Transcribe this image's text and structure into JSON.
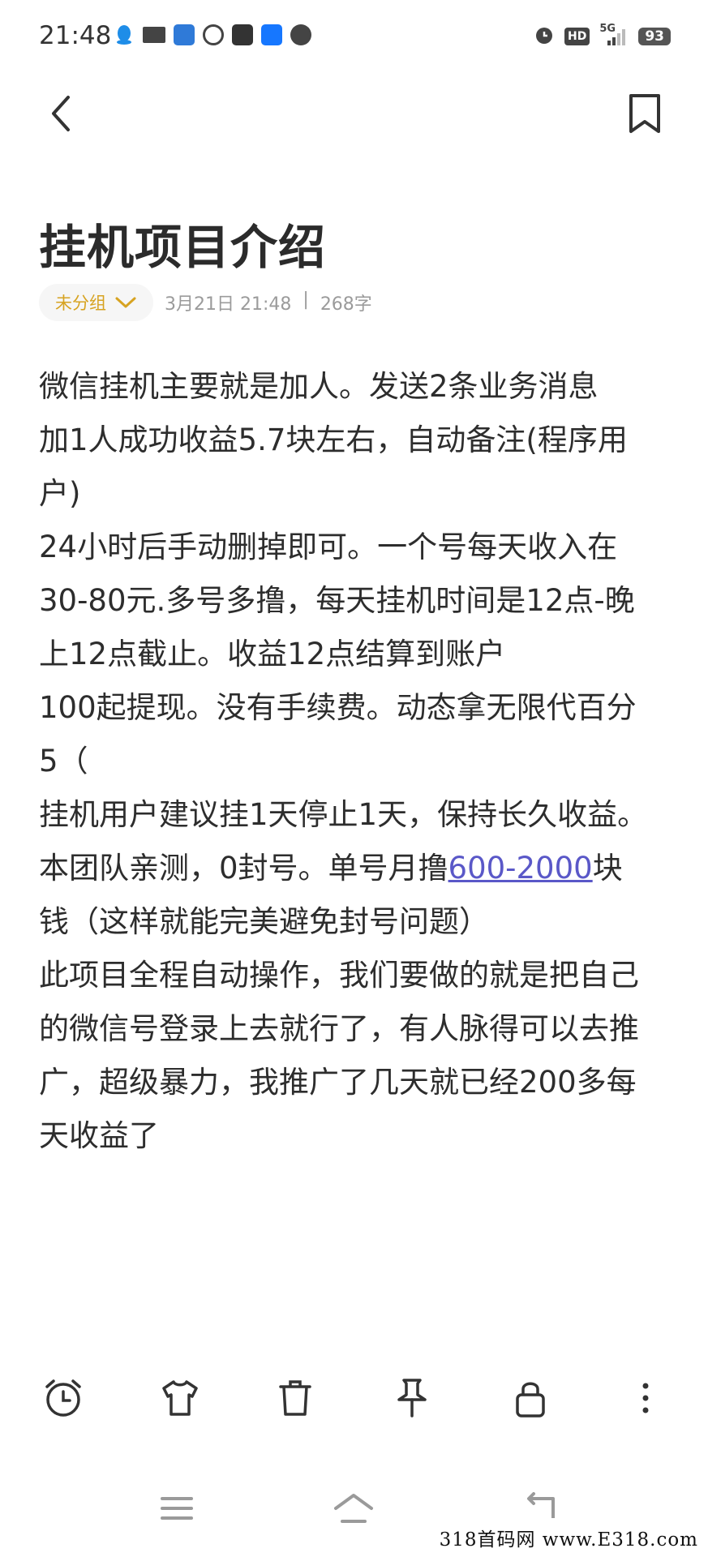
{
  "status_bar": {
    "time": "21:48",
    "notification_icons": [
      "qq-icon",
      "toutiao-icon",
      "signal-app-icon",
      "face-icon",
      "mail-icon",
      "alipay-icon",
      "compass-icon"
    ],
    "right_icons": [
      "alarm-icon",
      "hd-icon",
      "5g-signal-icon"
    ],
    "hd_label": "HD",
    "network_label": "5G",
    "battery": "93"
  },
  "note": {
    "title": "挂机项目介绍",
    "group": "未分组",
    "date": "3月21日 21:48",
    "separator": "|",
    "word_count": "268字",
    "body_lines": [
      "微信挂机主要就是加人。发送2条业务消息",
      "加1人成功收益5.7块左右，自动备注(程序用",
      "户)",
      "24小时后手动删掉即可。一个号每天收入在",
      "30-80元.多号多撸，每天挂机时间是12点-晚",
      "上12点截止。收益12点结算到账户",
      "100起提现。没有手续费。动态拿无限代百分",
      "5（",
      "挂机用户建议挂1天停止1天，保持长久收益。"
    ],
    "link_line": {
      "before": "本团队亲测，0封号。单号月撸",
      "link": "600-2000",
      "after": "块"
    },
    "body_lines_2": [
      "钱（这样就能完美避免封号问题）",
      "此项目全程自动操作，我们要做的就是把自己",
      "的微信号登录上去就行了，有人脉得可以去推",
      "广，超级暴力，我推广了几天就已经200多每",
      "天收益了"
    ]
  },
  "toolbar": {
    "items": [
      "alarm-clock-icon",
      "tshirt-icon",
      "trash-icon",
      "pin-icon",
      "lock-icon",
      "more-icon"
    ]
  },
  "navbar": {
    "items": [
      "menu-icon",
      "home-icon",
      "back-icon"
    ]
  },
  "watermark": "318首码网  www.E318.com",
  "colors": {
    "accent_group": "#d7a321",
    "link": "#5a58c8",
    "meta": "#9b9b9b"
  }
}
